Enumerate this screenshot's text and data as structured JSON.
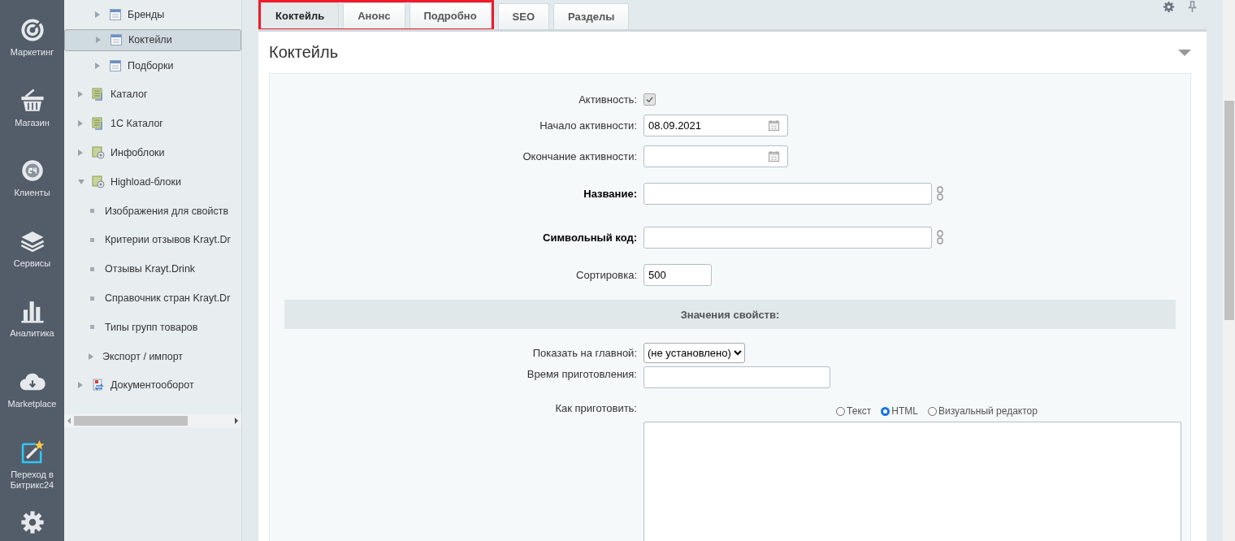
{
  "nav": [
    {
      "label": "Маркетинг",
      "kind": "target"
    },
    {
      "label": "Магазин",
      "kind": "basket"
    },
    {
      "label": "Клиенты",
      "kind": "badge24"
    },
    {
      "label": "Сервисы",
      "kind": "layers"
    },
    {
      "label": "Аналитика",
      "kind": "bars"
    },
    {
      "label": "Marketplace",
      "kind": "cloud"
    },
    {
      "label": "Переход в Битрикс24",
      "kind": "wand"
    },
    {
      "kind": "gear"
    }
  ],
  "tree": {
    "partial_children": [
      {
        "label": "Бренды",
        "kind": "list",
        "expanded": false,
        "selected": false
      },
      {
        "label": "Коктейли",
        "kind": "list",
        "expanded": false,
        "selected": true
      },
      {
        "label": "Подборки",
        "kind": "list",
        "expanded": false,
        "selected": false
      }
    ],
    "items": [
      {
        "label": "Каталог",
        "kind": "catalog",
        "expanded": false,
        "selected": false
      },
      {
        "label": "1С Каталог",
        "kind": "catalog",
        "expanded": false,
        "selected": false
      },
      {
        "label": "Инфоблоки",
        "kind": "iblock",
        "expanded": false,
        "selected": false
      },
      {
        "label": "Highload-блоки",
        "kind": "iblock",
        "expanded": true,
        "selected": false,
        "children": [
          {
            "label": "Изображения для свойств",
            "kind": "bullet",
            "selected": false
          },
          {
            "label": "Критерии отзывов Krayt.Dr",
            "kind": "bullet",
            "selected": false
          },
          {
            "label": "Отзывы Krayt.Drink",
            "kind": "bullet",
            "selected": false
          },
          {
            "label": "Справочник стран Krayt.Dr",
            "kind": "bullet",
            "selected": false
          },
          {
            "label": "Типы групп товаров",
            "kind": "bullet",
            "selected": false
          },
          {
            "label": "Экспорт / импорт",
            "kind": "folder",
            "expanded": false,
            "selected": false
          }
        ]
      },
      {
        "label": "Документооборот",
        "kind": "doc",
        "expanded": false,
        "selected": false
      }
    ]
  },
  "tabs": [
    {
      "label": "Коктейль",
      "selected": true,
      "highlighted": true
    },
    {
      "label": "Анонс",
      "selected": false,
      "highlighted": true
    },
    {
      "label": "Подробно",
      "selected": false,
      "highlighted": true
    },
    {
      "label": "SEO",
      "selected": false,
      "highlighted": false
    },
    {
      "label": "Разделы",
      "selected": false,
      "highlighted": false
    }
  ],
  "section": {
    "title": "Коктейль",
    "expanded": true
  },
  "fields": [
    {
      "kind": "checkbox",
      "label": "Активность:",
      "checked": true
    },
    {
      "kind": "date",
      "label": "Начало активности:",
      "value": "08.09.2021"
    },
    {
      "kind": "date",
      "label": "Окончание активности:"
    },
    {
      "kind": "text",
      "label": "Название:",
      "required": true,
      "linked": true
    },
    {
      "kind": "text",
      "label": "Символьный код:",
      "required": true,
      "linked": true
    },
    {
      "kind": "short",
      "label": "Сортировка:",
      "value": "500"
    },
    {
      "kind": "header",
      "label": "Значения свойств:"
    },
    {
      "kind": "select",
      "label": "Показать на главной:",
      "value": "(не установлено)"
    },
    {
      "kind": "medium",
      "label": "Время приготовления:"
    },
    {
      "kind": "editor",
      "label": "Как приготовить:",
      "modes": [
        {
          "label": "Текст",
          "selected": false
        },
        {
          "label": "HTML",
          "selected": true
        },
        {
          "label": "Визуальный редактор",
          "selected": false
        }
      ]
    }
  ]
}
